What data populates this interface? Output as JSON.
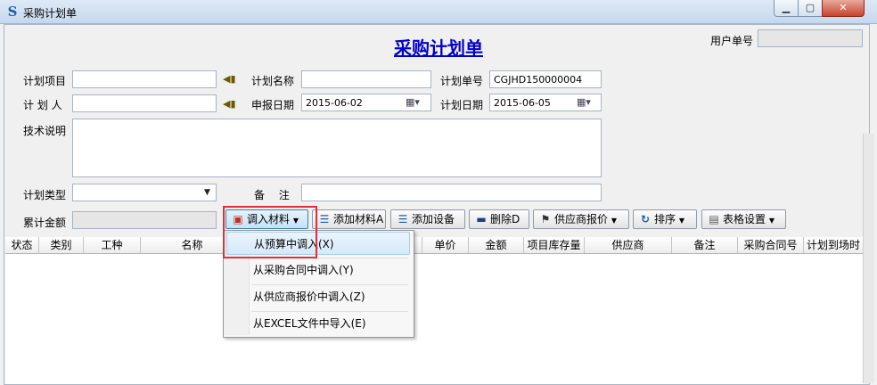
{
  "window": {
    "title": "采购计划单",
    "min_symbol": "▁",
    "max_symbol": "▢",
    "close_symbol": "✕"
  },
  "form": {
    "heading": "采购计划单",
    "user_no_label": "用户单号",
    "user_no_value": "",
    "plan_project_label": "计划项目",
    "plan_project_value": "",
    "plan_name_label": "计划名称",
    "plan_name_value": "",
    "plan_no_label": "计划单号",
    "plan_no_value": "CGJHD150000004",
    "planner_label": "计 划 人",
    "planner_value": "",
    "report_date_label": "申报日期",
    "report_date_value": "2015-06-02",
    "plan_date_label": "计划日期",
    "plan_date_value": "2015-06-05",
    "tech_desc_label": "技术说明",
    "tech_desc_value": "",
    "plan_type_label": "计划类型",
    "plan_type_value": "",
    "remark_label": "备　 注",
    "remark_value": "",
    "total_amount_label": "累计金额",
    "total_amount_value": ""
  },
  "toolbar": {
    "import_material": "调入材料",
    "add_material": "添加材料A",
    "add_equipment": "添加设备",
    "delete": "删除D",
    "supplier_quote": "供应商报价",
    "sort": "排序",
    "table_settings": "表格设置"
  },
  "grid": {
    "columns": [
      "状态",
      "类别",
      "工种",
      "名称",
      "单价",
      "金额",
      "项目库存量",
      "供应商",
      "备注",
      "采购合同号",
      "计划到场时"
    ]
  },
  "import_menu": {
    "items": [
      "从预算中调入(X)",
      "从采购合同中调入(Y)",
      "从供应商报价中调入(Z)",
      "从EXCEL文件中导入(E)"
    ]
  },
  "colors": {
    "heading": "#0000cc",
    "highlight_box": "#e0303a"
  }
}
